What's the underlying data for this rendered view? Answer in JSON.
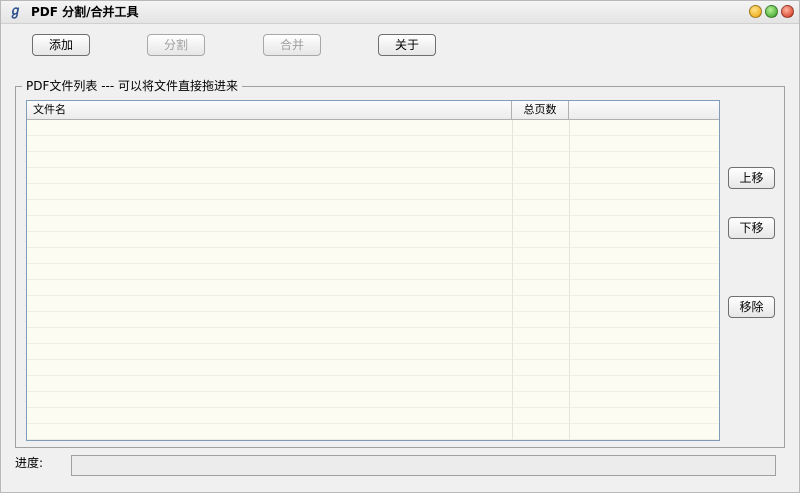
{
  "window": {
    "title": "PDF 分割/合并工具",
    "icon": "pdf-app-icon"
  },
  "toolbar": {
    "add_label": "添加",
    "split_label": "分割",
    "merge_label": "合并",
    "about_label": "关于"
  },
  "file_list": {
    "group_label": "PDF文件列表  --- 可以将文件直接拖进来",
    "columns": [
      "文件名",
      "总页数"
    ],
    "rows": []
  },
  "side_buttons": {
    "up_label": "上移",
    "down_label": "下移",
    "remove_label": "移除"
  },
  "progress": {
    "label": "进度:",
    "value": 0
  },
  "colors": {
    "list_background": "#fcfcf2",
    "window_background": "#f0f0f0"
  }
}
